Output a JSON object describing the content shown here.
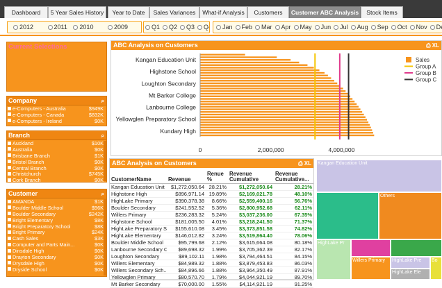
{
  "tabs": [
    {
      "label": "Dashboard",
      "active": false
    },
    {
      "label": "5 Year Sales History",
      "active": false
    },
    {
      "label": "Year to Date",
      "active": false
    },
    {
      "label": "Sales Variances",
      "active": false
    },
    {
      "label": "What-if Analysis",
      "active": false
    },
    {
      "label": "Customers",
      "active": false
    },
    {
      "label": "Customer ABC Analysis",
      "active": true
    },
    {
      "label": "Stock Items",
      "active": false
    }
  ],
  "filters": {
    "years": [
      "2012",
      "2011",
      "2010",
      "2009"
    ],
    "quarters": [
      "Q1",
      "Q2",
      "Q3",
      "Q4"
    ],
    "months": [
      "Jan",
      "Feb",
      "Mar",
      "Apr",
      "May",
      "Jun",
      "Jul",
      "Aug",
      "Sep",
      "Oct",
      "Nov",
      "Dec"
    ]
  },
  "current_selections": {
    "title": "Current Selections"
  },
  "company": {
    "title": "Company",
    "items": [
      {
        "name": "e-Computers - Australia",
        "value": "$949K"
      },
      {
        "name": "e-Computers - Canada",
        "value": "$832K"
      },
      {
        "name": "e-Computers - Ireland",
        "value": "$0K"
      }
    ]
  },
  "branch": {
    "title": "Branch",
    "items": [
      {
        "name": "Auckland",
        "value": "$10K"
      },
      {
        "name": "Australia",
        "value": "$0K"
      },
      {
        "name": "Brisbane Branch",
        "value": "$1K"
      },
      {
        "name": "Bristol Branch",
        "value": "$0K"
      },
      {
        "name": "Central Branch",
        "value": "$0K"
      },
      {
        "name": "Christchurch",
        "value": "$745K"
      },
      {
        "name": "Cork Branch",
        "value": "$0K"
      }
    ]
  },
  "customer": {
    "title": "Customer",
    "items": [
      {
        "name": "AMANDA",
        "value": "$1K"
      },
      {
        "name": "Boulder Middle School",
        "value": "$96K"
      },
      {
        "name": "Boulder Secondary",
        "value": "$242K"
      },
      {
        "name": "Bright Elementary",
        "value": "$8K"
      },
      {
        "name": "Bright Preparatory School",
        "value": "$8K"
      },
      {
        "name": "Bright Primary",
        "value": "$24K"
      },
      {
        "name": "Cash Sales",
        "value": "$3K"
      },
      {
        "name": "Computer and Parts Main...",
        "value": "$0K"
      },
      {
        "name": "Dinsdale High",
        "value": "$0K"
      },
      {
        "name": "Drayton Secondary",
        "value": "$0K"
      },
      {
        "name": "Drysdale High",
        "value": "$0K"
      },
      {
        "name": "Dryside School",
        "value": "$0K"
      }
    ]
  },
  "abc_chart": {
    "title": "ABC Analysis on Customers",
    "icons": "⎙ XL"
  },
  "chart_data": {
    "type": "bar",
    "orientation": "horizontal",
    "categories": [
      "Kangan Education Unit",
      "Highstone School",
      "Loughton Secondary",
      "Mt Barker College",
      "Lanbourne College",
      "Yellowglen Preparatory School",
      "Kundary High"
    ],
    "tick_labels_x": [
      "0",
      "2,000,000",
      "4,000,000"
    ],
    "xlim": [
      0,
      4700000
    ],
    "bar_count": 32,
    "bar_values": [
      1272050,
      896971,
      390378,
      241552,
      236283,
      181005,
      155610,
      146012,
      95799,
      89698,
      89102,
      84989,
      84896,
      80570,
      70000,
      68000,
      65000,
      62000,
      60000,
      58000,
      55000,
      52000,
      50000,
      48000,
      45000,
      42000,
      40000,
      38000,
      35000,
      32000,
      30000,
      28000
    ],
    "reference_lines": [
      {
        "name": "Group A",
        "value": 3250000,
        "color": "#f5c400"
      },
      {
        "name": "Group B",
        "value": 3950000,
        "color": "#e03a8c"
      },
      {
        "name": "Group C",
        "value": 4200000,
        "color": "#333333"
      }
    ],
    "legend": [
      {
        "name": "Sales",
        "color": "#f7941d"
      },
      {
        "name": "Group A",
        "color": "#f5c400"
      },
      {
        "name": "Group B",
        "color": "#e03a8c"
      },
      {
        "name": "Group C",
        "color": "#333333"
      }
    ],
    "legend_position": "right"
  },
  "abc_table": {
    "title": "ABC Analysis on Customers",
    "icons": "⎙ XL",
    "columns": [
      "CustomerName",
      "Revenue",
      "Renue %",
      "Revenue Cumulative",
      "Revenue Cumulative..."
    ],
    "rows": [
      [
        "Kangan Education Unit",
        "$1,272,050.64",
        "28.21%",
        "$1,272,050.64",
        "28.21%"
      ],
      [
        "Highstone High",
        "$896,971.14",
        "19.89%",
        "$2,169,021.78",
        "48.10%"
      ],
      [
        "HighLake Primary",
        "$390,378.38",
        "8.66%",
        "$2,559,400.16",
        "56.76%"
      ],
      [
        "Boulder Secondary",
        "$241,552.52",
        "5.36%",
        "$2,800,952.68",
        "62.11%"
      ],
      [
        "Willers Primary",
        "$236,283.32",
        "5.24%",
        "$3,037,236.00",
        "67.35%"
      ],
      [
        "Highstone School",
        "$181,005.50",
        "4.01%",
        "$3,218,241.50",
        "71.37%"
      ],
      [
        "HighLake Preparatory S...",
        "$155,610.08",
        "3.45%",
        "$3,373,851.58",
        "74.82%"
      ],
      [
        "HighLake Elementary",
        "$146,012.82",
        "3.24%",
        "$3,519,864.40",
        "78.06%"
      ],
      [
        "Boulder Middle School",
        "$95,799.68",
        "2.12%",
        "$3,615,664.08",
        "80.18%"
      ],
      [
        "Lanbourne Secondary C...",
        "$89,698.32",
        "1.99%",
        "$3,705,362.39",
        "82.17%"
      ],
      [
        "Loughton Secondary",
        "$89,102.11",
        "1.98%",
        "$3,794,464.51",
        "84.15%"
      ],
      [
        "Willers Elementary",
        "$84,989.32",
        "1.88%",
        "$3,879,453.83",
        "86.03%"
      ],
      [
        "Willers Secondary Sch...",
        "$84,896.66",
        "1.88%",
        "$3,964,350.49",
        "87.91%"
      ],
      [
        "Yellowglen Primary",
        "$80,570.70",
        "1.79%",
        "$4,044,921.19",
        "89.70%"
      ],
      [
        "Mt Barker Secondary",
        "$70,000.00",
        "1.55%",
        "$4,114,921.19",
        "91.25%"
      ]
    ]
  },
  "treemap": {
    "cells": [
      {
        "label": "Kangan Education Unit",
        "color": "#c9c4e6"
      },
      {
        "label": "",
        "color": "#2bbd8a"
      },
      {
        "label": "Others",
        "color": "#f08a1f"
      },
      {
        "label": "HighLake Pr",
        "color": "#b9e6b0"
      },
      {
        "label": "",
        "color": "#e040a0"
      },
      {
        "label": "",
        "color": "#3aa84a"
      },
      {
        "label": "Willers Primary",
        "color": "#f7941d"
      },
      {
        "label": "HighLake Pre",
        "color": "#c9c4e6"
      },
      {
        "label": "Bo",
        "color": "#e8e03a"
      },
      {
        "label": "HighLake Ele",
        "color": "#b0b0b0"
      },
      {
        "label": "",
        "color": "#f7941d"
      }
    ]
  }
}
